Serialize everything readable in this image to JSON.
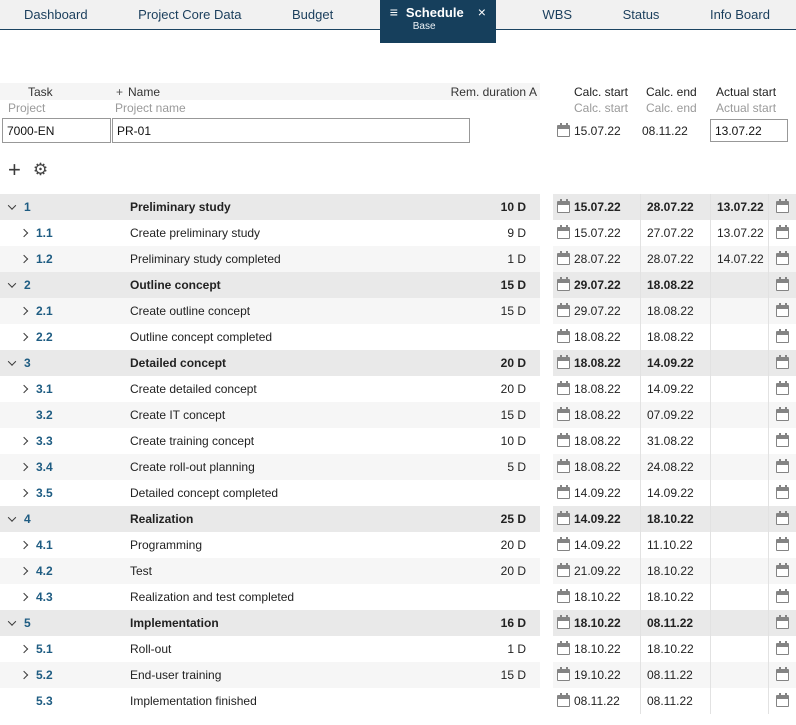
{
  "tabs": [
    {
      "label": "Dashboard"
    },
    {
      "label": "Project Core Data"
    },
    {
      "label": "Budget"
    },
    {
      "label": "Schedule",
      "sublabel": "Base",
      "active": true
    },
    {
      "label": "WBS"
    },
    {
      "label": "Status"
    },
    {
      "label": "Info Board"
    }
  ],
  "icons": {
    "menu": "≡",
    "close": "×",
    "add": "+",
    "settings": "⚙"
  },
  "colors": {
    "accent": "#163f5c",
    "number_blue": "#1e5c82"
  },
  "header": {
    "task": "Task",
    "plus": "+",
    "name": "Name",
    "rem_duration": "Rem. duration",
    "a": "A",
    "project": "Project",
    "project_name": "Project name",
    "calc_start": "Calc. start",
    "calc_end": "Calc. end",
    "actual_start": "Actual start"
  },
  "subheader": {
    "calc_start": "Calc. start",
    "calc_end": "Calc. end",
    "actual_start": "Actual start"
  },
  "project": {
    "id": "7000-EN",
    "name": "PR-01",
    "calc_start": "15.07.22",
    "calc_end": "08.11.22",
    "actual_start": "13.07.22"
  },
  "rows": [
    {
      "num": "1",
      "name": "Preliminary study",
      "dur": "10 D",
      "calc_start": "15.07.22",
      "calc_end": "28.07.22",
      "actual_start": "13.07.22",
      "group": true,
      "chevron": "down"
    },
    {
      "num": "1.1",
      "name": "Create preliminary study",
      "dur": "9 D",
      "calc_start": "15.07.22",
      "calc_end": "27.07.22",
      "actual_start": "13.07.22",
      "group": false,
      "chevron": "right"
    },
    {
      "num": "1.2",
      "name": "Preliminary study completed",
      "dur": "1 D",
      "calc_start": "28.07.22",
      "calc_end": "28.07.22",
      "actual_start": "14.07.22",
      "group": false,
      "chevron": "right"
    },
    {
      "num": "2",
      "name": "Outline concept",
      "dur": "15 D",
      "calc_start": "29.07.22",
      "calc_end": "18.08.22",
      "actual_start": "",
      "group": true,
      "chevron": "down"
    },
    {
      "num": "2.1",
      "name": "Create outline concept",
      "dur": "15 D",
      "calc_start": "29.07.22",
      "calc_end": "18.08.22",
      "actual_start": "",
      "group": false,
      "chevron": "right"
    },
    {
      "num": "2.2",
      "name": "Outline concept completed",
      "dur": "",
      "calc_start": "18.08.22",
      "calc_end": "18.08.22",
      "actual_start": "",
      "group": false,
      "chevron": "right"
    },
    {
      "num": "3",
      "name": "Detailed concept",
      "dur": "20 D",
      "calc_start": "18.08.22",
      "calc_end": "14.09.22",
      "actual_start": "",
      "group": true,
      "chevron": "down"
    },
    {
      "num": "3.1",
      "name": "Create detailed concept",
      "dur": "20 D",
      "calc_start": "18.08.22",
      "calc_end": "14.09.22",
      "actual_start": "",
      "group": false,
      "chevron": "right"
    },
    {
      "num": "3.2",
      "name": "Create IT concept",
      "dur": "15 D",
      "calc_start": "18.08.22",
      "calc_end": "07.09.22",
      "actual_start": "",
      "group": false,
      "chevron": "none"
    },
    {
      "num": "3.3",
      "name": "Create training concept",
      "dur": "10 D",
      "calc_start": "18.08.22",
      "calc_end": "31.08.22",
      "actual_start": "",
      "group": false,
      "chevron": "right"
    },
    {
      "num": "3.4",
      "name": "Create roll-out planning",
      "dur": "5 D",
      "calc_start": "18.08.22",
      "calc_end": "24.08.22",
      "actual_start": "",
      "group": false,
      "chevron": "right"
    },
    {
      "num": "3.5",
      "name": "Detailed concept completed",
      "dur": "",
      "calc_start": "14.09.22",
      "calc_end": "14.09.22",
      "actual_start": "",
      "group": false,
      "chevron": "right"
    },
    {
      "num": "4",
      "name": "Realization",
      "dur": "25 D",
      "calc_start": "14.09.22",
      "calc_end": "18.10.22",
      "actual_start": "",
      "group": true,
      "chevron": "down"
    },
    {
      "num": "4.1",
      "name": "Programming",
      "dur": "20 D",
      "calc_start": "14.09.22",
      "calc_end": "11.10.22",
      "actual_start": "",
      "group": false,
      "chevron": "right"
    },
    {
      "num": "4.2",
      "name": "Test",
      "dur": "20 D",
      "calc_start": "21.09.22",
      "calc_end": "18.10.22",
      "actual_start": "",
      "group": false,
      "chevron": "right"
    },
    {
      "num": "4.3",
      "name": "Realization and test completed",
      "dur": "",
      "calc_start": "18.10.22",
      "calc_end": "18.10.22",
      "actual_start": "",
      "group": false,
      "chevron": "right"
    },
    {
      "num": "5",
      "name": "Implementation",
      "dur": "16 D",
      "calc_start": "18.10.22",
      "calc_end": "08.11.22",
      "actual_start": "",
      "group": true,
      "chevron": "down"
    },
    {
      "num": "5.1",
      "name": "Roll-out",
      "dur": "1 D",
      "calc_start": "18.10.22",
      "calc_end": "18.10.22",
      "actual_start": "",
      "group": false,
      "chevron": "right"
    },
    {
      "num": "5.2",
      "name": "End-user training",
      "dur": "15 D",
      "calc_start": "19.10.22",
      "calc_end": "08.11.22",
      "actual_start": "",
      "group": false,
      "chevron": "right"
    },
    {
      "num": "5.3",
      "name": "Implementation finished",
      "dur": "",
      "calc_start": "08.11.22",
      "calc_end": "08.11.22",
      "actual_start": "",
      "group": false,
      "chevron": "none"
    }
  ]
}
